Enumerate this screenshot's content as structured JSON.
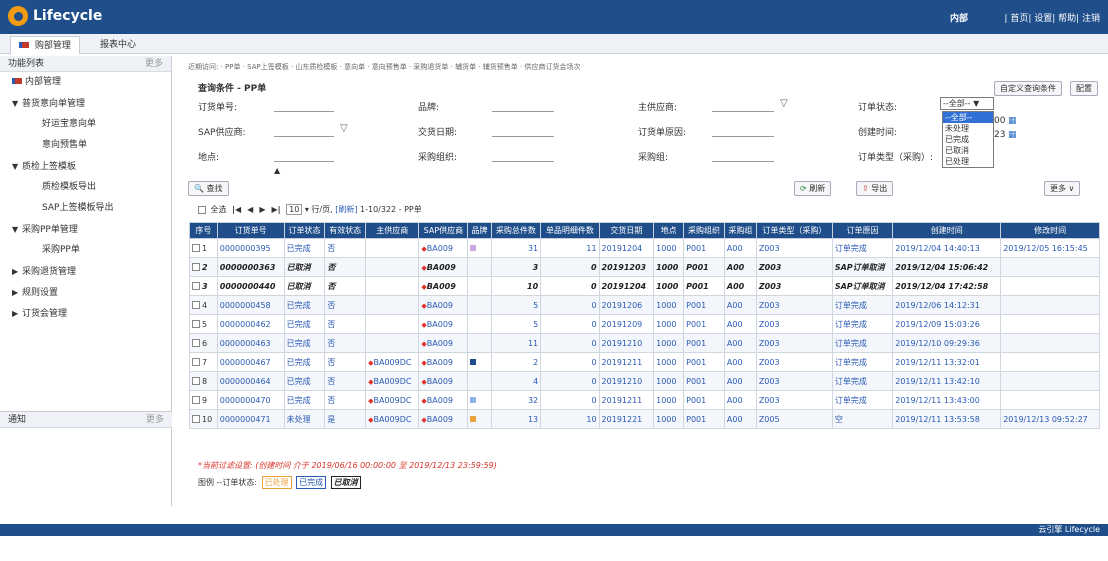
{
  "app": {
    "title": "Lifecycle",
    "user": "内部",
    "links": "| 首页| 设置| 帮助| 注销"
  },
  "tabs": [
    "购部管理",
    "报表中心"
  ],
  "sidebar": {
    "title": "功能列表",
    "more": "更多",
    "items": [
      {
        "label": "内部管理",
        "level": 0,
        "arrow": ""
      },
      {
        "label": "普货意向单管理",
        "level": 0,
        "arrow": "▼"
      },
      {
        "label": "好运宝意向单",
        "level": 1,
        "arrow": ""
      },
      {
        "label": "意向预售单",
        "level": 1,
        "arrow": ""
      },
      {
        "label": "质检上签模板",
        "level": 0,
        "arrow": "▼"
      },
      {
        "label": "质检模板导出",
        "level": 1,
        "arrow": ""
      },
      {
        "label": "SAP上签模板导出",
        "level": 1,
        "arrow": ""
      },
      {
        "label": "采购PP单管理",
        "level": 0,
        "arrow": "▼"
      },
      {
        "label": "采购PP单",
        "level": 1,
        "arrow": ""
      },
      {
        "label": "采购退货管理",
        "level": 0,
        "arrow": "▶"
      },
      {
        "label": "规则设置",
        "level": 0,
        "arrow": "▶"
      },
      {
        "label": "订货会管理",
        "level": 0,
        "arrow": "▶"
      }
    ],
    "notify_title": "通知",
    "notify_more": "更多"
  },
  "crumb": "近期访问: · PP单 · SAP上签模板 · 山东质检模板 · 意向单 · 意向预售单 · 采购退货单 · 辅货单 · 辅货预售单 · 供应商订货会场次",
  "query": {
    "title": "查询条件 - PP单",
    "custom_btn": "自定义查询条件",
    "config_btn": "配置",
    "labels": {
      "order_no": "订货单号:",
      "brand": "品牌:",
      "main_supplier": "主供应商:",
      "order_status": "订单状态:",
      "sap_supplier": "SAP供应商:",
      "delivery_date": "交货日期:",
      "reason": "订货单原因:",
      "created": "创建时间:",
      "location": "地点:",
      "purch_org": "采购组织:",
      "purch_group": "采购组:",
      "order_type": "订单类型（采购）:"
    },
    "status_selected": "--全部-- ▼",
    "status_options": [
      "--全部--",
      "未处理",
      "已完成",
      "已取消",
      "已处理"
    ],
    "created_partial": [
      "00",
      "23"
    ]
  },
  "toolbar": {
    "search": "查找",
    "refresh": "刷新",
    "export": "导出",
    "more": "更多"
  },
  "pager": {
    "select_all": "全选",
    "page_size": "10",
    "per_page": "行/页,",
    "refresh": "[刷新]",
    "range": "1-10/322 - PP单"
  },
  "table": {
    "headers": [
      "序号",
      "订货单号",
      "订单状态",
      "有效状态",
      "主供应商",
      "SAP供应商",
      "品牌",
      "采购总件数",
      "单品明细件数",
      "交货日期",
      "地点",
      "采购组织",
      "采购组",
      "订单类型（采购）",
      "订单原因",
      "创建时间",
      "修改时间"
    ],
    "rows": [
      {
        "idx": "1",
        "no": "0000000395",
        "status": "已完成",
        "valid": "否",
        "main_sup": "",
        "sap": "BA009",
        "brand_color": "#c9a6e0",
        "total": "31",
        "detail": "11",
        "date": "20191204",
        "loc": "1000",
        "org": "P001",
        "grp": "A00",
        "type": "Z003",
        "reason": "订单完成",
        "created": "2019/12/04 14:40:13",
        "modified": "2019/12/05 16:15:45",
        "cancel": false
      },
      {
        "idx": "2",
        "no": "0000000363",
        "status": "已取消",
        "valid": "否",
        "main_sup": "",
        "sap": "BA009",
        "brand_color": "",
        "total": "3",
        "detail": "0",
        "date": "20191203",
        "loc": "1000",
        "org": "P001",
        "grp": "A00",
        "type": "Z003",
        "reason": "SAP订单取消",
        "created": "2019/12/04 15:06:42",
        "modified": "",
        "cancel": true
      },
      {
        "idx": "3",
        "no": "0000000440",
        "status": "已取消",
        "valid": "否",
        "main_sup": "",
        "sap": "BA009",
        "brand_color": "",
        "total": "10",
        "detail": "0",
        "date": "20191204",
        "loc": "1000",
        "org": "P001",
        "grp": "A00",
        "type": "Z003",
        "reason": "SAP订单取消",
        "created": "2019/12/04 17:42:58",
        "modified": "",
        "cancel": true
      },
      {
        "idx": "4",
        "no": "0000000458",
        "status": "已完成",
        "valid": "否",
        "main_sup": "",
        "sap": "BA009",
        "brand_color": "",
        "total": "5",
        "detail": "0",
        "date": "20191206",
        "loc": "1000",
        "org": "P001",
        "grp": "A00",
        "type": "Z003",
        "reason": "订单完成",
        "created": "2019/12/06 14:12:31",
        "modified": "",
        "cancel": false
      },
      {
        "idx": "5",
        "no": "0000000462",
        "status": "已完成",
        "valid": "否",
        "main_sup": "",
        "sap": "BA009",
        "brand_color": "",
        "total": "5",
        "detail": "0",
        "date": "20191209",
        "loc": "1000",
        "org": "P001",
        "grp": "A00",
        "type": "Z003",
        "reason": "订单完成",
        "created": "2019/12/09 15:03:26",
        "modified": "",
        "cancel": false
      },
      {
        "idx": "6",
        "no": "0000000463",
        "status": "已完成",
        "valid": "否",
        "main_sup": "",
        "sap": "BA009",
        "brand_color": "",
        "total": "11",
        "detail": "0",
        "date": "20191210",
        "loc": "1000",
        "org": "P001",
        "grp": "A00",
        "type": "Z003",
        "reason": "订单完成",
        "created": "2019/12/10 09:29:36",
        "modified": "",
        "cancel": false
      },
      {
        "idx": "7",
        "no": "0000000467",
        "status": "已完成",
        "valid": "否",
        "main_sup": "BA009DC",
        "sap": "BA009",
        "brand_color": "#1f4e8a",
        "total": "2",
        "detail": "0",
        "date": "20191211",
        "loc": "1000",
        "org": "P001",
        "grp": "A00",
        "type": "Z003",
        "reason": "订单完成",
        "created": "2019/12/11 13:32:01",
        "modified": "",
        "cancel": false
      },
      {
        "idx": "8",
        "no": "0000000464",
        "status": "已完成",
        "valid": "否",
        "main_sup": "BA009DC",
        "sap": "BA009",
        "brand_color": "",
        "total": "4",
        "detail": "0",
        "date": "20191210",
        "loc": "1000",
        "org": "P001",
        "grp": "A00",
        "type": "Z003",
        "reason": "订单完成",
        "created": "2019/12/11 13:42:10",
        "modified": "",
        "cancel": false
      },
      {
        "idx": "9",
        "no": "0000000470",
        "status": "已完成",
        "valid": "否",
        "main_sup": "BA009DC",
        "sap": "BA009",
        "brand_color": "#8ab4e8",
        "total": "32",
        "detail": "0",
        "date": "20191211",
        "loc": "1000",
        "org": "P001",
        "grp": "A00",
        "type": "Z003",
        "reason": "订单完成",
        "created": "2019/12/11 13:43:00",
        "modified": "",
        "cancel": false
      },
      {
        "idx": "10",
        "no": "0000000471",
        "status": "未处理",
        "valid": "是",
        "main_sup": "BA009DC",
        "sap": "BA009",
        "brand_color": "#e8a33d",
        "total": "13",
        "detail": "10",
        "date": "20191221",
        "loc": "1000",
        "org": "P001",
        "grp": "A00",
        "type": "Z005",
        "reason": "空",
        "created": "2019/12/11 13:53:58",
        "modified": "2019/12/13 09:52:27",
        "cancel": false
      }
    ]
  },
  "filter_note": "*当前过滤设置: (创建时间 介于 2019/06/16 00:00:00 至 2019/12/13 23:59:59)",
  "legend": {
    "title": "图例",
    "item": "--订单状态:",
    "a": "已处理",
    "b": "已完成",
    "c": "已取消"
  },
  "footer": "云引擎  Lifecycle"
}
